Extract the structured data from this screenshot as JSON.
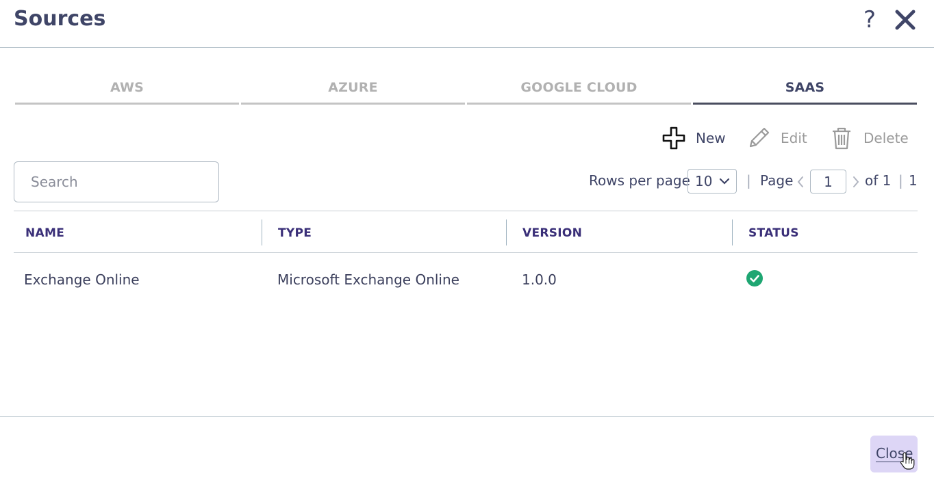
{
  "dialog": {
    "title": "Sources",
    "help_icon": "?",
    "close_icon": "close-icon"
  },
  "tabs": [
    {
      "label": "AWS",
      "active": false
    },
    {
      "label": "AZURE",
      "active": false
    },
    {
      "label": "GOOGLE CLOUD",
      "active": false
    },
    {
      "label": "SAAS",
      "active": true
    }
  ],
  "toolbar": {
    "new_label": "New",
    "edit_label": "Edit",
    "delete_label": "Delete"
  },
  "search": {
    "placeholder": "Search",
    "value": ""
  },
  "pagination": {
    "rows_per_page_label": "Rows per page",
    "rows_per_page_value": "10",
    "separator": "|",
    "page_label": "Page",
    "current_page": "1",
    "of_label": "of 1",
    "total": "1"
  },
  "table": {
    "columns": [
      "NAME",
      "TYPE",
      "VERSION",
      "STATUS"
    ],
    "rows": [
      {
        "name": "Exchange Online",
        "type": "Microsoft Exchange Online",
        "version": "1.0.0",
        "status": "ok"
      }
    ]
  },
  "footer": {
    "close_label": "Close"
  },
  "colors": {
    "title": "#3f4567",
    "header_text": "#3a2f78",
    "status_ok": "#1ea672",
    "close_button_bg": "#ddd6f6",
    "inactive_tab": "#b1b1b1"
  }
}
